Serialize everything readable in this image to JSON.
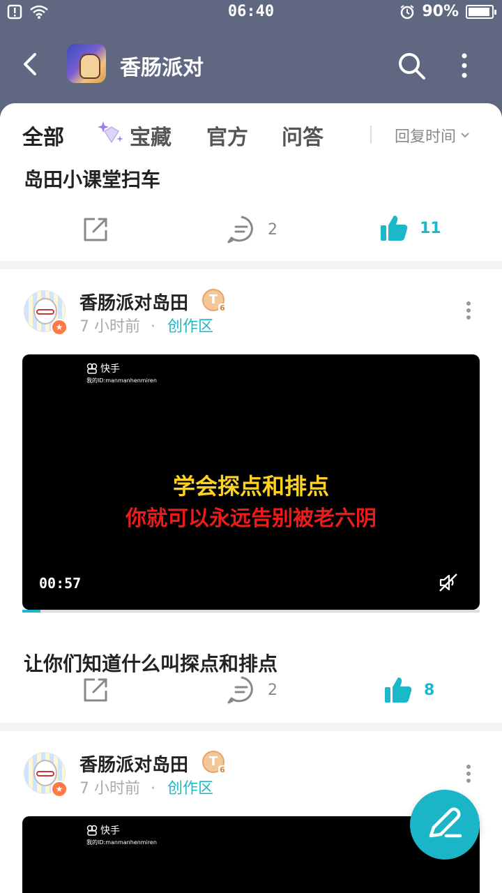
{
  "status_bar": {
    "time": "06:40",
    "battery": "90%"
  },
  "header": {
    "title": "香肠派对"
  },
  "tabs": {
    "items": [
      {
        "label": "全部"
      },
      {
        "label": "宝藏"
      },
      {
        "label": "官方"
      },
      {
        "label": "问答"
      }
    ],
    "active_index": 0,
    "sort_label": "回复时间"
  },
  "posts": [
    {
      "title": "岛田小课堂扫车",
      "comment_count": "2",
      "like_count": "11",
      "liked": true
    },
    {
      "author": "香肠派对岛田",
      "level_letter": "T",
      "level_num": "6",
      "time_ago": "7 小时前",
      "separator": "·",
      "category": "创作区",
      "video": {
        "brand": "快手",
        "user_id": "我的ID:manmanhenmiren",
        "caption_line1": "学会探点和排点",
        "caption_line2": "你就可以永远告别被老六阴",
        "duration": "00:57",
        "progress": 0.04
      },
      "title": "让你们知道什么叫探点和排点",
      "comment_count": "2",
      "like_count": "8",
      "liked": true
    },
    {
      "author": "香肠派对岛田",
      "level_letter": "T",
      "level_num": "6",
      "time_ago": "7 小时前",
      "separator": "·",
      "category": "创作区",
      "video": {
        "brand": "快手",
        "user_id": "我的ID:manmanhenmiren"
      }
    }
  ],
  "colors": {
    "accent": "#1cb8c9",
    "header_bg": "#5f6781",
    "badge_orange": "#ff7a45"
  }
}
